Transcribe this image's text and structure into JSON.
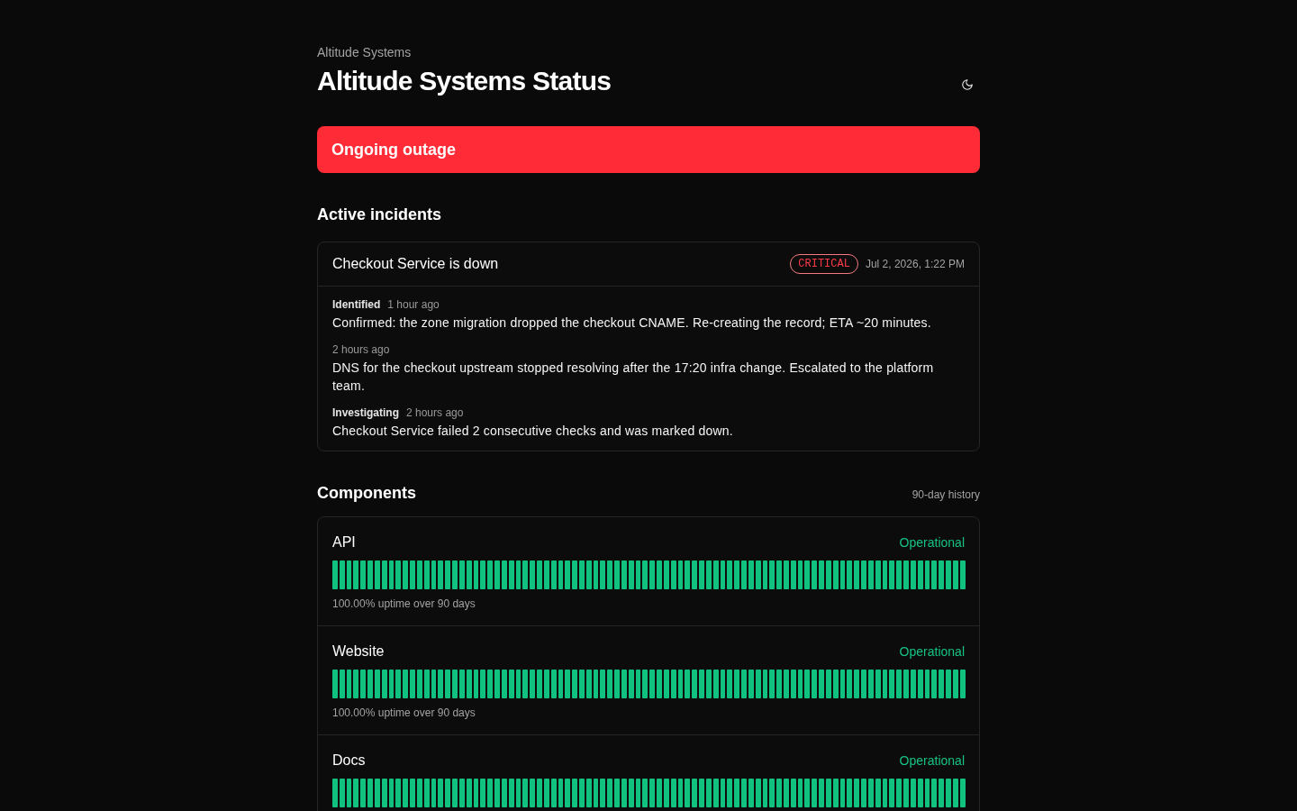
{
  "header": {
    "brand": "Altitude Systems",
    "title": "Altitude Systems Status"
  },
  "banner": {
    "text": "Ongoing outage"
  },
  "incidents_section": {
    "title": "Active incidents"
  },
  "incidents": [
    {
      "title": "Checkout Service is down",
      "severity": "CRITICAL",
      "date": "Jul 2, 2026, 1:22 PM",
      "updates": [
        {
          "status": "Identified",
          "time": "1 hour ago",
          "message": "Confirmed: the zone migration dropped the checkout CNAME. Re-creating the record; ETA ~20 minutes."
        },
        {
          "time": "2 hours ago",
          "message": "DNS for the checkout upstream stopped resolving after the 17:20 infra change. Escalated to the platform team."
        },
        {
          "status": "Investigating",
          "time": "2 hours ago",
          "message": "Checkout Service failed 2 consecutive checks and was marked down."
        }
      ]
    }
  ],
  "components_section": {
    "title": "Components",
    "history_label": "90-day history"
  },
  "components": [
    {
      "name": "API",
      "status": "Operational",
      "uptime": "100.00% uptime over 90 days",
      "history": [
        {
          "up": true
        },
        {
          "up": true
        },
        {
          "up": true
        },
        {
          "up": true
        },
        {
          "up": true
        },
        {
          "up": true
        },
        {
          "up": true
        },
        {
          "up": true
        },
        {
          "up": true
        },
        {
          "up": true
        },
        {
          "up": true
        },
        {
          "up": true
        },
        {
          "up": true
        },
        {
          "up": true
        },
        {
          "up": true
        },
        {
          "up": true
        },
        {
          "up": true
        },
        {
          "up": true
        },
        {
          "up": true
        },
        {
          "up": true
        },
        {
          "up": true
        },
        {
          "up": true
        },
        {
          "up": true
        },
        {
          "up": true
        },
        {
          "up": true
        },
        {
          "up": true
        },
        {
          "up": true
        },
        {
          "up": true
        },
        {
          "up": true
        },
        {
          "up": true
        },
        {
          "up": true
        },
        {
          "up": true
        },
        {
          "up": true
        },
        {
          "up": true
        },
        {
          "up": true
        },
        {
          "up": true
        },
        {
          "up": true
        },
        {
          "up": true
        },
        {
          "up": true
        },
        {
          "up": true
        },
        {
          "up": true
        },
        {
          "up": true
        },
        {
          "up": true
        },
        {
          "up": true
        },
        {
          "up": true
        },
        {
          "up": true
        },
        {
          "up": true
        },
        {
          "up": true
        },
        {
          "up": true
        },
        {
          "up": true
        },
        {
          "up": true
        },
        {
          "up": true
        },
        {
          "up": true
        },
        {
          "up": true
        },
        {
          "up": true
        },
        {
          "up": true
        },
        {
          "up": true
        },
        {
          "up": true
        },
        {
          "up": true
        },
        {
          "up": true
        },
        {
          "up": true
        },
        {
          "up": true
        },
        {
          "up": true
        },
        {
          "up": true
        },
        {
          "up": true
        },
        {
          "up": true
        },
        {
          "up": true
        },
        {
          "up": true
        },
        {
          "up": true
        },
        {
          "up": true
        },
        {
          "up": true
        },
        {
          "up": true
        },
        {
          "up": true
        },
        {
          "up": true
        },
        {
          "up": true
        },
        {
          "up": true
        },
        {
          "up": true
        },
        {
          "up": true
        },
        {
          "up": true
        },
        {
          "up": true
        },
        {
          "up": true
        },
        {
          "up": true
        },
        {
          "up": true
        },
        {
          "up": true
        },
        {
          "up": true
        },
        {
          "up": true
        },
        {
          "up": true
        },
        {
          "up": true
        },
        {
          "up": true
        },
        {
          "up": true
        }
      ]
    },
    {
      "name": "Website",
      "status": "Operational",
      "uptime": "100.00% uptime over 90 days",
      "history": [
        {
          "up": true
        },
        {
          "up": true
        },
        {
          "up": true
        },
        {
          "up": true
        },
        {
          "up": true
        },
        {
          "up": true
        },
        {
          "up": true
        },
        {
          "up": true
        },
        {
          "up": true
        },
        {
          "up": true
        },
        {
          "up": true
        },
        {
          "up": true
        },
        {
          "up": true
        },
        {
          "up": true
        },
        {
          "up": true
        },
        {
          "up": true
        },
        {
          "up": true
        },
        {
          "up": true
        },
        {
          "up": true
        },
        {
          "up": true
        },
        {
          "up": true
        },
        {
          "up": true
        },
        {
          "up": true
        },
        {
          "up": true
        },
        {
          "up": true
        },
        {
          "up": true
        },
        {
          "up": true
        },
        {
          "up": true
        },
        {
          "up": true
        },
        {
          "up": true
        },
        {
          "up": true
        },
        {
          "up": true
        },
        {
          "up": true
        },
        {
          "up": true
        },
        {
          "up": true
        },
        {
          "up": true
        },
        {
          "up": true
        },
        {
          "up": true
        },
        {
          "up": true
        },
        {
          "up": true
        },
        {
          "up": true
        },
        {
          "up": true
        },
        {
          "up": true
        },
        {
          "up": true
        },
        {
          "up": true
        },
        {
          "up": true
        },
        {
          "up": true
        },
        {
          "up": true
        },
        {
          "up": true
        },
        {
          "up": true
        },
        {
          "up": true
        },
        {
          "up": true
        },
        {
          "up": true
        },
        {
          "up": true
        },
        {
          "up": true
        },
        {
          "up": true
        },
        {
          "up": true
        },
        {
          "up": true
        },
        {
          "up": true
        },
        {
          "up": true
        },
        {
          "up": true
        },
        {
          "up": true
        },
        {
          "up": true
        },
        {
          "up": true
        },
        {
          "up": true
        },
        {
          "up": true
        },
        {
          "up": true
        },
        {
          "up": true
        },
        {
          "up": true
        },
        {
          "up": true
        },
        {
          "up": true
        },
        {
          "up": true
        },
        {
          "up": true
        },
        {
          "up": true
        },
        {
          "up": true
        },
        {
          "up": true
        },
        {
          "up": true
        },
        {
          "up": true
        },
        {
          "up": true
        },
        {
          "up": true
        },
        {
          "up": true
        },
        {
          "up": true
        },
        {
          "up": true
        },
        {
          "up": true
        },
        {
          "up": true
        },
        {
          "up": true
        },
        {
          "up": true
        },
        {
          "up": true
        },
        {
          "up": true
        },
        {
          "up": true
        }
      ]
    },
    {
      "name": "Docs",
      "status": "Operational",
      "history": [
        {
          "up": true
        },
        {
          "up": true
        },
        {
          "up": true
        },
        {
          "up": true
        },
        {
          "up": true
        },
        {
          "up": true
        },
        {
          "up": true
        },
        {
          "up": true
        },
        {
          "up": true
        },
        {
          "up": true
        },
        {
          "up": true
        },
        {
          "up": true
        },
        {
          "up": true
        },
        {
          "up": true
        },
        {
          "up": true
        },
        {
          "up": true
        },
        {
          "up": true
        },
        {
          "up": true
        },
        {
          "up": true
        },
        {
          "up": true
        },
        {
          "up": true
        },
        {
          "up": true
        },
        {
          "up": true
        },
        {
          "up": true
        },
        {
          "up": true
        },
        {
          "up": true
        },
        {
          "up": true
        },
        {
          "up": true
        },
        {
          "up": true
        },
        {
          "up": true
        },
        {
          "up": true
        },
        {
          "up": true
        },
        {
          "up": true
        },
        {
          "up": true
        },
        {
          "up": true
        },
        {
          "up": true
        },
        {
          "up": true
        },
        {
          "up": true
        },
        {
          "up": true
        },
        {
          "up": true
        },
        {
          "up": true
        },
        {
          "up": true
        },
        {
          "up": true
        },
        {
          "up": true
        },
        {
          "up": true
        },
        {
          "up": true
        },
        {
          "up": true
        },
        {
          "up": true
        },
        {
          "up": true
        },
        {
          "up": true
        },
        {
          "up": true
        },
        {
          "up": true
        },
        {
          "up": true
        },
        {
          "up": true
        },
        {
          "up": true
        },
        {
          "up": true
        },
        {
          "up": true
        },
        {
          "up": true
        },
        {
          "up": true
        },
        {
          "up": true
        },
        {
          "up": true
        },
        {
          "up": true
        },
        {
          "up": true
        },
        {
          "up": true
        },
        {
          "up": true
        },
        {
          "up": true
        },
        {
          "up": true
        },
        {
          "up": true
        },
        {
          "up": true
        },
        {
          "up": true
        },
        {
          "up": true
        },
        {
          "up": true
        },
        {
          "up": true
        },
        {
          "up": true
        },
        {
          "up": true
        },
        {
          "up": true
        },
        {
          "up": true
        },
        {
          "up": true
        },
        {
          "up": true
        },
        {
          "up": true
        },
        {
          "up": true
        },
        {
          "up": true
        },
        {
          "up": true
        },
        {
          "up": true
        },
        {
          "up": true
        },
        {
          "up": true
        },
        {
          "up": true
        },
        {
          "up": true
        },
        {
          "up": true
        },
        {
          "up": true
        }
      ]
    }
  ]
}
